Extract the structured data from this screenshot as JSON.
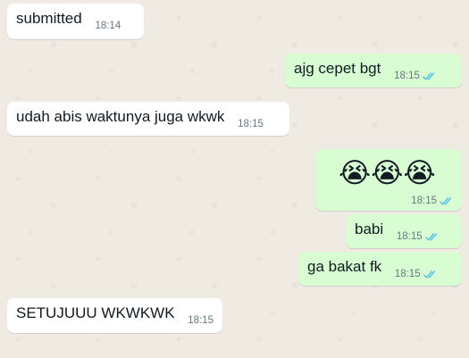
{
  "messages": [
    {
      "direction": "incoming",
      "text": "submitted",
      "time": "18:14"
    },
    {
      "direction": "outgoing",
      "text": "ajg cepet bgt",
      "time": "18:15",
      "status": "read-double-check"
    },
    {
      "direction": "incoming",
      "text": "udah abis waktunya juga wkwk",
      "time": "18:15"
    },
    {
      "direction": "outgoing",
      "text": "😭😭😭",
      "time": "18:15",
      "status": "read-double-check"
    },
    {
      "direction": "outgoing",
      "text": "babi",
      "time": "18:15",
      "status": "read-double-check"
    },
    {
      "direction": "outgoing",
      "text": "ga bakat fk",
      "time": "18:15",
      "status": "read-double-check"
    },
    {
      "direction": "incoming",
      "text": "SETUJUUU WKWKWK",
      "time": "18:15"
    }
  ],
  "colors": {
    "wallpaper": "#efeae2",
    "incoming_bubble": "#ffffff",
    "outgoing_bubble": "#d9fdd3",
    "timestamp": "#667781",
    "read_ticks": "#53bdeb",
    "text": "#111b21"
  },
  "icons": {
    "read_status": "double-check-icon"
  }
}
